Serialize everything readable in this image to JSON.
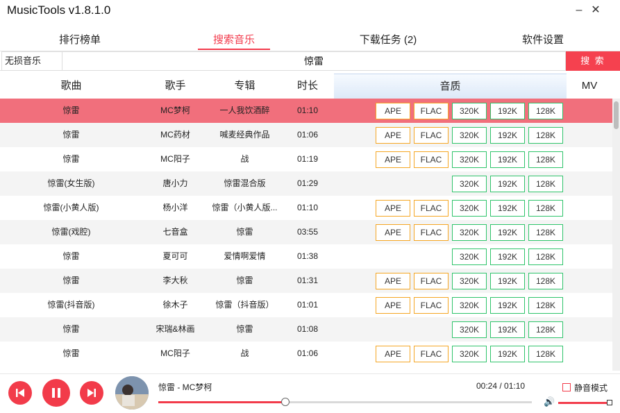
{
  "app": {
    "title": "MusicTools v1.8.1.0",
    "minimize": "–",
    "close": "✕"
  },
  "tabs": [
    {
      "label": "排行榜单"
    },
    {
      "label": "搜索音乐"
    },
    {
      "label": "下载任务 (2)"
    },
    {
      "label": "软件设置"
    }
  ],
  "search": {
    "source": "无损音乐",
    "query": "惊雷",
    "button": "搜 索"
  },
  "columns": {
    "song": "歌曲",
    "artist": "歌手",
    "album": "专辑",
    "duration": "时长",
    "quality": "音质",
    "mv": "MV"
  },
  "rows": [
    {
      "song": "惊雷",
      "artist": "MC梦柯",
      "album": "一人我饮酒醉",
      "duration": "01:10",
      "q": [
        "APE",
        "FLAC",
        "320K",
        "192K",
        "128K"
      ]
    },
    {
      "song": "惊雷",
      "artist": "MC药材",
      "album": "喊麦经典作品",
      "duration": "01:06",
      "q": [
        "APE",
        "FLAC",
        "320K",
        "192K",
        "128K"
      ]
    },
    {
      "song": "惊雷",
      "artist": "MC阳子",
      "album": "战",
      "duration": "01:19",
      "q": [
        "APE",
        "FLAC",
        "320K",
        "192K",
        "128K"
      ]
    },
    {
      "song": "惊雷(女生版)",
      "artist": "唐小力",
      "album": "惊雷混合版",
      "duration": "01:29",
      "q": [
        "",
        "",
        "320K",
        "192K",
        "128K"
      ]
    },
    {
      "song": "惊雷(小黄人版)",
      "artist": "杨小洋",
      "album": "惊雷（小黄人版...",
      "duration": "01:10",
      "q": [
        "APE",
        "FLAC",
        "320K",
        "192K",
        "128K"
      ]
    },
    {
      "song": "惊雷(戏腔)",
      "artist": "七音盒",
      "album": "惊雷",
      "duration": "03:55",
      "q": [
        "APE",
        "FLAC",
        "320K",
        "192K",
        "128K"
      ]
    },
    {
      "song": "惊雷",
      "artist": "夏可可",
      "album": "爱情啊爱情",
      "duration": "01:38",
      "q": [
        "",
        "",
        "320K",
        "192K",
        "128K"
      ]
    },
    {
      "song": "惊雷",
      "artist": "李大秋",
      "album": "惊雷",
      "duration": "01:31",
      "q": [
        "APE",
        "FLAC",
        "320K",
        "192K",
        "128K"
      ]
    },
    {
      "song": "惊雷(抖音版)",
      "artist": "徐木子",
      "album": "惊雷（抖音版）",
      "duration": "01:01",
      "q": [
        "APE",
        "FLAC",
        "320K",
        "192K",
        "128K"
      ]
    },
    {
      "song": "惊雷",
      "artist": "宋瑞&林画",
      "album": "惊雷",
      "duration": "01:08",
      "q": [
        "",
        "",
        "320K",
        "192K",
        "128K"
      ]
    },
    {
      "song": "惊雷",
      "artist": "MC阳子",
      "album": "战",
      "duration": "01:06",
      "q": [
        "APE",
        "FLAC",
        "320K",
        "192K",
        "128K"
      ]
    }
  ],
  "selected_row": 0,
  "player": {
    "now_playing": "惊雷 - MC梦柯",
    "time": "00:24 / 01:10",
    "progress": 0.34,
    "mute_label": "静音模式",
    "volume": 0.97,
    "volume_icon": "🔊"
  },
  "colors": {
    "accent": "#f23b4a",
    "selected_row": "#f16f7c",
    "lossless_border": "#f5a623",
    "mp3_border": "#2ec46a"
  }
}
